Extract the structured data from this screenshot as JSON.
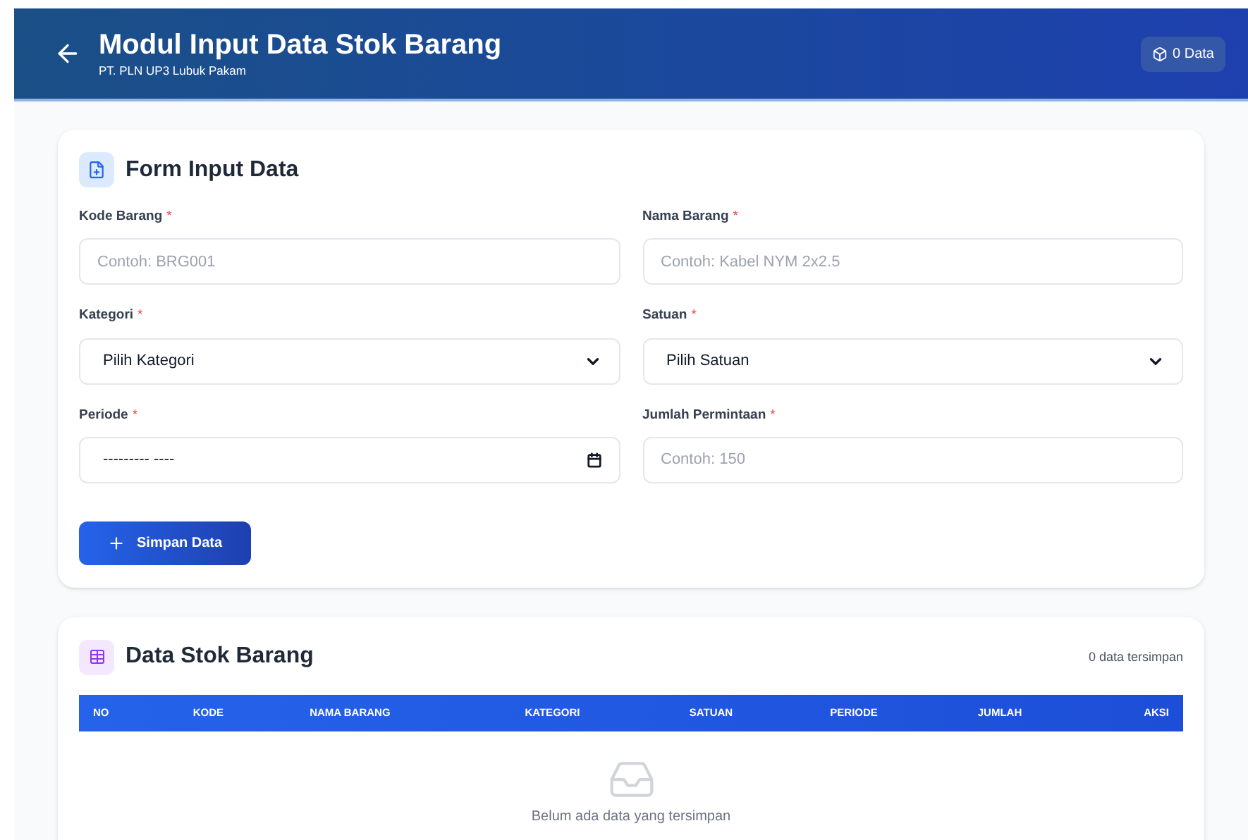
{
  "header": {
    "title": "Modul Input Data Stok Barang",
    "subtitle": "PT. PLN UP3 Lubuk Pakam",
    "badge": "0 Data"
  },
  "form": {
    "title": "Form Input Data",
    "fields": [
      {
        "label": "Kode Barang",
        "mark": "*",
        "kind": "text",
        "placeholder": "Contoh: BRG001"
      },
      {
        "label": "Nama Barang",
        "mark": "*",
        "kind": "text",
        "placeholder": "Contoh: Kabel NYM 2x2.5"
      },
      {
        "label": "Kategori",
        "mark": "*",
        "kind": "select",
        "value": "Pilih Kategori"
      },
      {
        "label": "Satuan",
        "mark": "*",
        "kind": "select",
        "value": "Pilih Satuan"
      },
      {
        "label": "Periode",
        "mark": "*",
        "kind": "month",
        "value": "--------- ----"
      },
      {
        "label": "Jumlah Permintaan",
        "mark": "*",
        "kind": "text",
        "placeholder": "Contoh: 150"
      }
    ],
    "submit": "Simpan Data"
  },
  "table": {
    "title": "Data Stok Barang",
    "count": "0 data tersimpan",
    "columns": [
      "NO",
      "KODE",
      "NAMA BARANG",
      "KATEGORI",
      "SATUAN",
      "PERIODE",
      "JUMLAH",
      "AKSI"
    ],
    "empty": "Belum ada data yang tersimpan"
  }
}
